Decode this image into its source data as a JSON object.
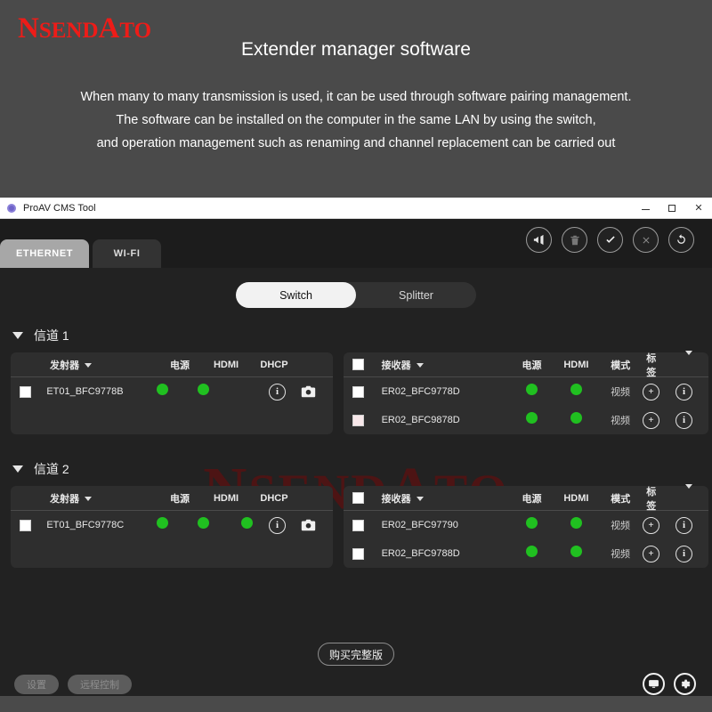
{
  "promo": {
    "logo": "NSENDATO",
    "title": "Extender manager software",
    "lines": [
      "When many to many transmission is used, it can be used through software pairing management.",
      " The software can be installed on the computer in the same LAN by using the switch,",
      "and operation management such as renaming and channel replacement can be carried out"
    ]
  },
  "window": {
    "title": "ProAV CMS Tool",
    "minimize_label": "–",
    "maximize_label": "□",
    "close_label": "✕"
  },
  "toolbar": {
    "icons": [
      {
        "name": "broadcast-icon",
        "tooltip": "broadcast"
      },
      {
        "name": "trash-icon",
        "tooltip": "delete"
      },
      {
        "name": "check-icon",
        "tooltip": "confirm"
      },
      {
        "name": "close-x-icon",
        "tooltip": "cancel"
      },
      {
        "name": "refresh-icon",
        "tooltip": "refresh"
      }
    ]
  },
  "tabs": [
    {
      "label": "ETHERNET",
      "active": true
    },
    {
      "label": "WI-FI",
      "active": false
    }
  ],
  "mode_switch": {
    "options": [
      "Switch",
      "Splitter"
    ],
    "selected": "Switch"
  },
  "watermark": "NSENDATO",
  "tx_headers": {
    "name": "发射器",
    "power": "电源",
    "hdmi": "HDMI",
    "dhcp": "DHCP"
  },
  "rx_headers": {
    "name": "接收器",
    "power": "电源",
    "hdmi": "HDMI",
    "mode": "模式",
    "tag": "标签"
  },
  "channels": [
    {
      "title": "信道 1",
      "expanded": true,
      "transmitters": [
        {
          "checked": false,
          "checkbox_style": "white",
          "name": "ET01_BFC9778B",
          "power": true,
          "hdmi": true,
          "dhcp": false,
          "actions": [
            "info-icon",
            "camera-icon"
          ]
        }
      ],
      "receivers": [
        {
          "checked": false,
          "checkbox_style": "white",
          "name": "ER02_BFC9778D",
          "power": true,
          "hdmi": true,
          "mode": "视频",
          "actions": [
            "plus-icon",
            "info-icon"
          ]
        },
        {
          "checked": false,
          "checkbox_style": "pink",
          "name": "ER02_BFC9878D",
          "power": true,
          "hdmi": true,
          "mode": "视频",
          "actions": [
            "plus-icon",
            "info-icon"
          ]
        }
      ]
    },
    {
      "title": "信道 2",
      "expanded": true,
      "transmitters": [
        {
          "checked": false,
          "checkbox_style": "white",
          "name": "ET01_BFC9778C",
          "power": true,
          "hdmi": true,
          "dhcp": true,
          "actions": [
            "info-icon",
            "camera-icon"
          ]
        }
      ],
      "receivers": [
        {
          "checked": false,
          "checkbox_style": "white",
          "name": "ER02_BFC97790",
          "power": true,
          "hdmi": true,
          "mode": "视频",
          "actions": [
            "plus-icon",
            "info-icon"
          ]
        },
        {
          "checked": false,
          "checkbox_style": "white",
          "name": "ER02_BFC9788D",
          "power": true,
          "hdmi": true,
          "mode": "视频",
          "actions": [
            "plus-icon",
            "info-icon"
          ]
        }
      ]
    }
  ],
  "footer": {
    "buy_label": "购买完整版",
    "settings_label": "设置",
    "remote_label": "远程控制",
    "right_icons": [
      {
        "name": "monitor-icon"
      },
      {
        "name": "gear-icon"
      }
    ]
  },
  "colors": {
    "brand_red": "#ee1c18",
    "status_green": "#20c020",
    "promo_bg": "#4a4a4a",
    "app_bg": "#222222",
    "panel_bg": "#2e2e2e",
    "accent_white": "#f2f2f2"
  }
}
